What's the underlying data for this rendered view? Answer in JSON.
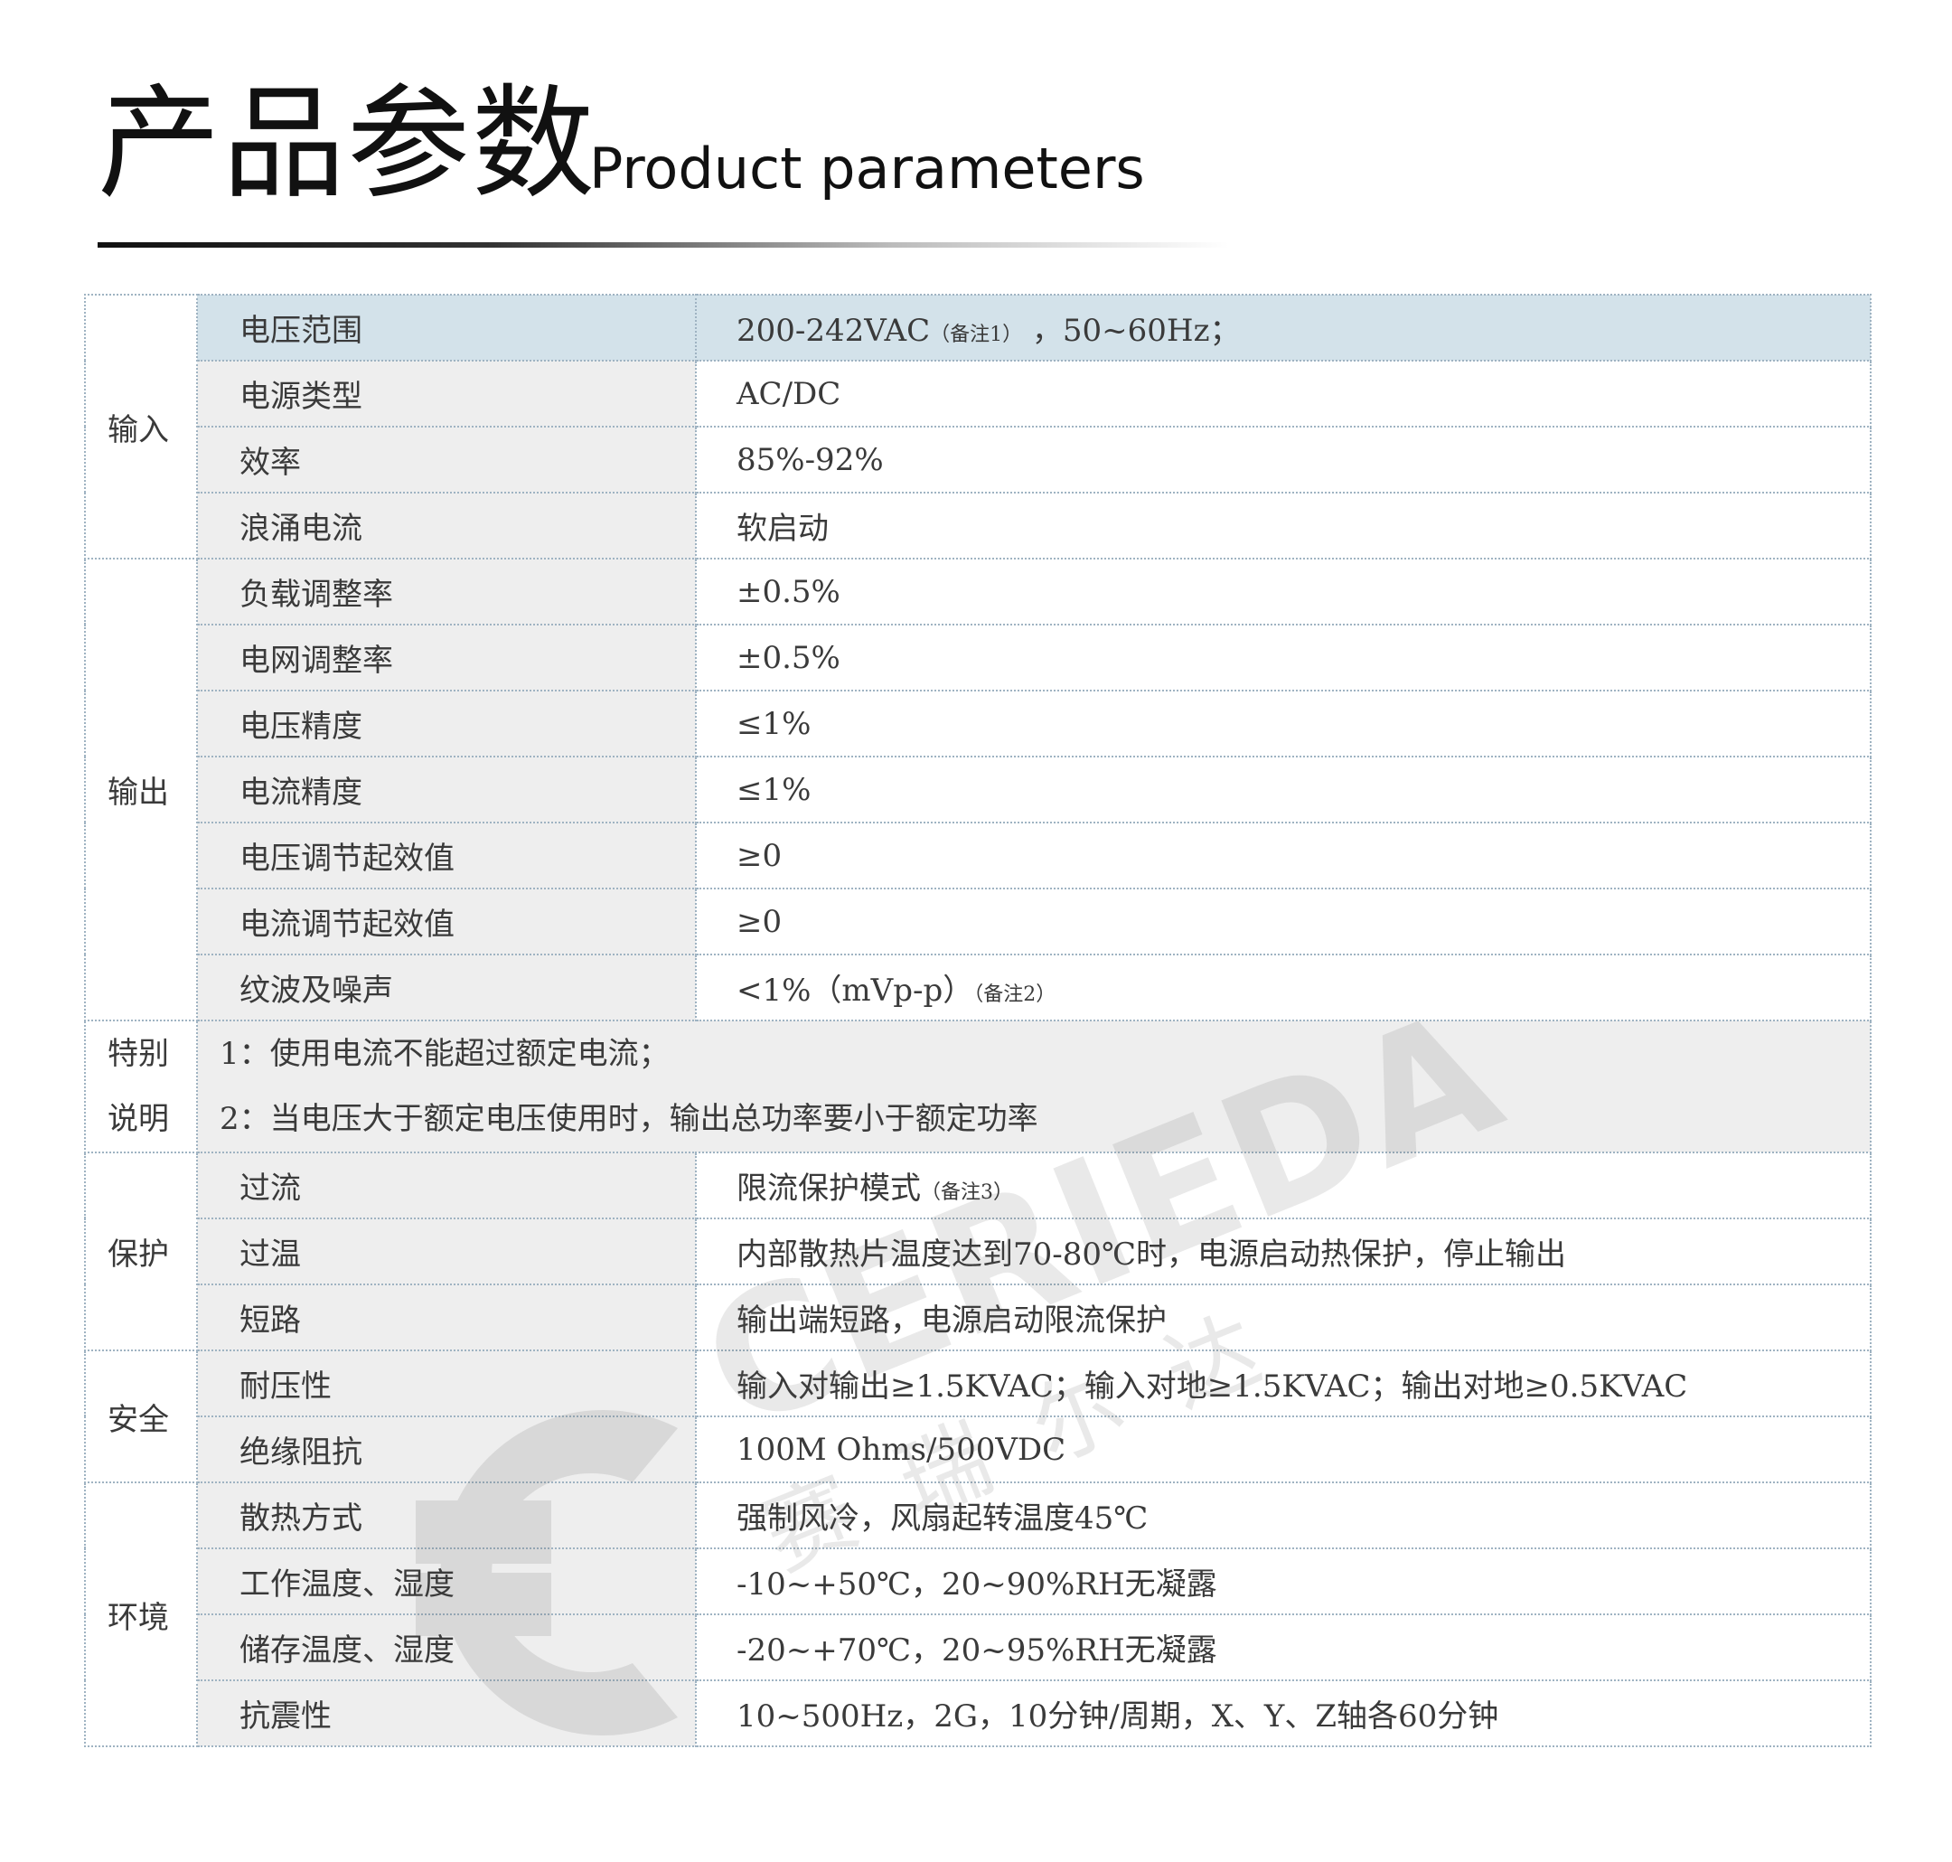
{
  "title_cn": "产品参数",
  "title_en": "Product parameters",
  "sections": [
    {
      "category": "输入",
      "rows": [
        {
          "name": "电压范围",
          "value": "200-242VAC",
          "note": "（备注1）",
          "value_suffix": " ，50~60Hz；",
          "highlight": true
        },
        {
          "name": "电源类型",
          "value": "AC/DC"
        },
        {
          "name": "效率",
          "value": "85%-92%"
        },
        {
          "name": "浪涌电流",
          "value": "软启动"
        }
      ]
    },
    {
      "category": "输出",
      "rows": [
        {
          "name": "负载调整率",
          "value": "±0.5%"
        },
        {
          "name": "电网调整率",
          "value": "±0.5%"
        },
        {
          "name": "电压精度",
          "value": "≤1%"
        },
        {
          "name": "电流精度",
          "value": "≤1%"
        },
        {
          "name": "电压调节起效值",
          "value": "≥0"
        },
        {
          "name": "电流调节起效值",
          "value": "≥0"
        },
        {
          "name": "纹波及噪声",
          "value": "<1%（mVp-p）",
          "note": "（备注2）"
        }
      ]
    },
    {
      "category": "特别说明",
      "notes": [
        "1：使用电流不能超过额定电流；",
        "2：当电压大于额定电压使用时，输出总功率要小于额定功率"
      ]
    },
    {
      "category": "保护",
      "rows": [
        {
          "name": "过流",
          "value": "限流保护模式",
          "note": "（备注3）"
        },
        {
          "name": "过温",
          "value": "内部散热片温度达到70-80℃时，电源启动热保护，停止输出"
        },
        {
          "name": "短路",
          "value": "输出端短路，电源启动限流保护"
        }
      ]
    },
    {
      "category": "安全",
      "rows": [
        {
          "name": "耐压性",
          "value": "输入对输出≥1.5KVAC；输入对地≥1.5KVAC；输出对地≥0.5KVAC"
        },
        {
          "name": "绝缘阻抗",
          "value": "100M Ohms/500VDC"
        }
      ]
    },
    {
      "category": "环境",
      "rows": [
        {
          "name": "散热方式",
          "value": "强制风冷，风扇起转温度45℃"
        },
        {
          "name": "工作温度、湿度",
          "value": "-10~+50℃，20~90%RH无凝露"
        },
        {
          "name": "储存温度、湿度",
          "value": "-20~+70℃，20~95%RH无凝露"
        },
        {
          "name": "抗震性",
          "value": "10~500Hz，2G，10分钟/周期，X、Y、Z轴各60分钟"
        }
      ]
    }
  ],
  "watermark": {
    "brand": "CERIEDA",
    "name_cn": "赛瑞尔达"
  }
}
